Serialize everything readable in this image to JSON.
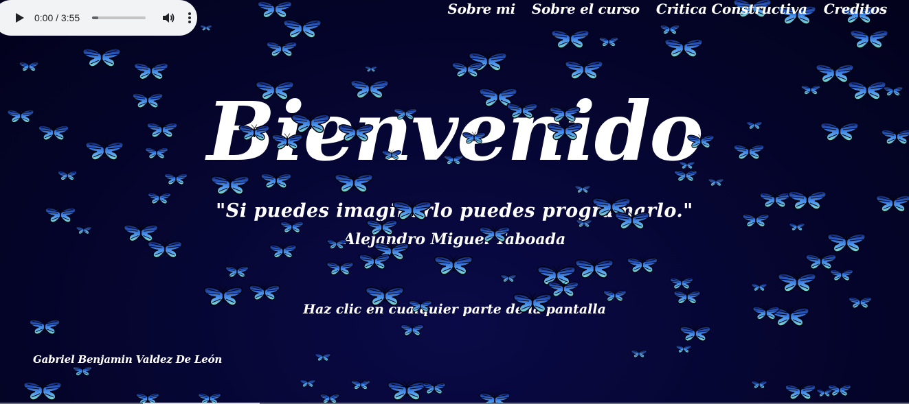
{
  "player": {
    "time": "0:00 / 3:55",
    "progress_fraction": 0.12
  },
  "nav": {
    "items": [
      {
        "label": "Sobre mi"
      },
      {
        "label": "Sobre el curso"
      },
      {
        "label": "Critica Constructiva"
      },
      {
        "label": "Creditos"
      }
    ]
  },
  "main": {
    "title": "Bienvenido",
    "quote": "\"Si puedes imaginarlo puedes programarlo.\"",
    "author": "Alejandro Miguel Taboada",
    "hint": "Haz clic en cualquier parte de la pantalla"
  },
  "footer": {
    "signature": "Gabriel Benjamin Valdez De León"
  },
  "colors": {
    "background": "#05052e",
    "butterfly_wing": "#2f6bd8",
    "butterfly_edge": "#04040f",
    "text": "#ffffff"
  },
  "icons": [
    "play-icon",
    "volume-icon",
    "more-options-icon",
    "butterfly-icon"
  ]
}
